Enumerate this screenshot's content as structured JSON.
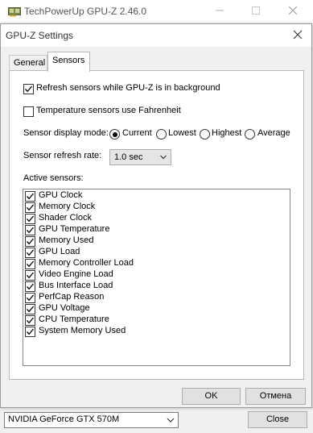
{
  "main_window": {
    "title": "TechPowerUp GPU-Z 2.46.0",
    "gpu_select_value": "NVIDIA GeForce GTX 570M",
    "close_label": "Close"
  },
  "dialog": {
    "title": "GPU-Z Settings",
    "tabs": [
      {
        "label": "General",
        "active": false
      },
      {
        "label": "Sensors",
        "active": true
      }
    ],
    "refresh_background": {
      "label": "Refresh sensors while GPU-Z is in background",
      "checked": true
    },
    "fahrenheit": {
      "label": "Temperature sensors use Fahrenheit",
      "checked": false
    },
    "display_mode": {
      "label": "Sensor display mode:",
      "options": [
        "Current",
        "Lowest",
        "Highest",
        "Average"
      ],
      "selected": "Current"
    },
    "refresh_rate": {
      "label": "Sensor refresh rate:",
      "value": "1.0 sec"
    },
    "active_sensors": {
      "label": "Active sensors:",
      "items": [
        {
          "label": "GPU Clock",
          "checked": true
        },
        {
          "label": "Memory Clock",
          "checked": true
        },
        {
          "label": "Shader Clock",
          "checked": true
        },
        {
          "label": "GPU Temperature",
          "checked": true
        },
        {
          "label": "Memory Used",
          "checked": true
        },
        {
          "label": "GPU Load",
          "checked": true
        },
        {
          "label": "Memory Controller Load",
          "checked": true
        },
        {
          "label": "Video Engine Load",
          "checked": true
        },
        {
          "label": "Bus Interface Load",
          "checked": true
        },
        {
          "label": "PerfCap Reason",
          "checked": true
        },
        {
          "label": "GPU Voltage",
          "checked": true
        },
        {
          "label": "CPU Temperature",
          "checked": true
        },
        {
          "label": "System Memory Used",
          "checked": true
        }
      ]
    },
    "ok_label": "OK",
    "cancel_label": "Отмена"
  },
  "icons": {
    "app": "gpu-card-icon",
    "check": "checkmark-icon",
    "dropdown": "chevron-down-icon",
    "close": "close-icon",
    "minimize": "minimize-icon",
    "maximize": "maximize-icon"
  }
}
